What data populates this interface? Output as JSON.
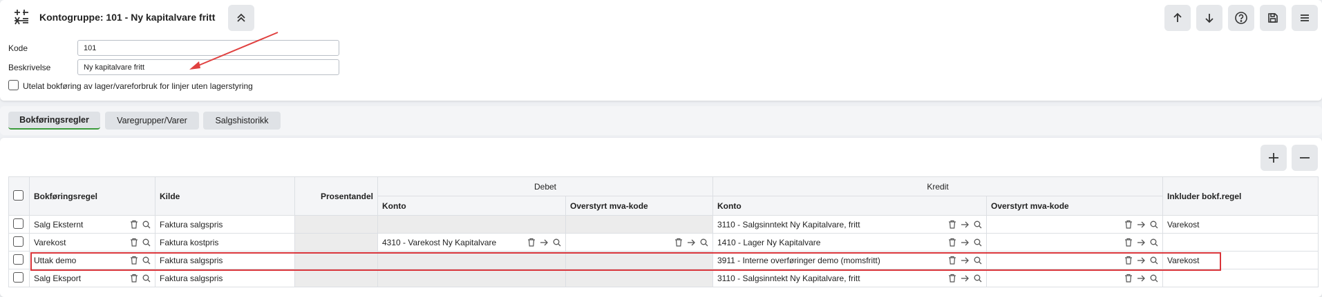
{
  "header": {
    "title": "Kontogruppe: 101 - Ny kapitalvare fritt"
  },
  "form": {
    "kode_label": "Kode",
    "kode_value": "101",
    "beskrivelse_label": "Beskrivelse",
    "beskrivelse_value": "Ny kapitalvare fritt",
    "checkbox_label": "Utelat bokføring av lager/vareforbruk for linjer uten lagerstyring"
  },
  "tabs": [
    {
      "label": "Bokføringsregler",
      "active": true
    },
    {
      "label": "Varegrupper/Varer",
      "active": false
    },
    {
      "label": "Salgshistorikk",
      "active": false
    }
  ],
  "grid": {
    "headers": {
      "regel": "Bokføringsregel",
      "kilde": "Kilde",
      "prosent": "Prosentandel",
      "debet": "Debet",
      "kredit": "Kredit",
      "debet_konto": "Konto",
      "debet_mva": "Overstyrt mva-kode",
      "kredit_konto": "Konto",
      "kredit_mva": "Overstyrt mva-kode",
      "inkluder": "Inkluder bokf.regel"
    },
    "rows": [
      {
        "regel": "Salg Eksternt",
        "kilde": "Faktura salgspris",
        "debet_konto": "",
        "kredit_konto": "3110 - Salgsinntekt Ny Kapitalvare, fritt",
        "inkluder": "Varekost"
      },
      {
        "regel": "Varekost",
        "kilde": "Faktura kostpris",
        "debet_konto": "4310 - Varekost Ny Kapitalvare",
        "kredit_konto": "1410 - Lager Ny Kapitalvare",
        "inkluder": ""
      },
      {
        "regel": "Uttak demo",
        "kilde": "Faktura salgspris",
        "debet_konto": "",
        "kredit_konto": "3911 - Interne overføringer demo (momsfritt)",
        "inkluder": "Varekost"
      },
      {
        "regel": "Salg Eksport",
        "kilde": "Faktura salgspris",
        "debet_konto": "",
        "kredit_konto": "3110 - Salgsinntekt Ny Kapitalvare, fritt",
        "inkluder": ""
      }
    ]
  },
  "colors": {
    "accent_green": "#3a9a3a",
    "annotation_red": "#d9343a"
  }
}
